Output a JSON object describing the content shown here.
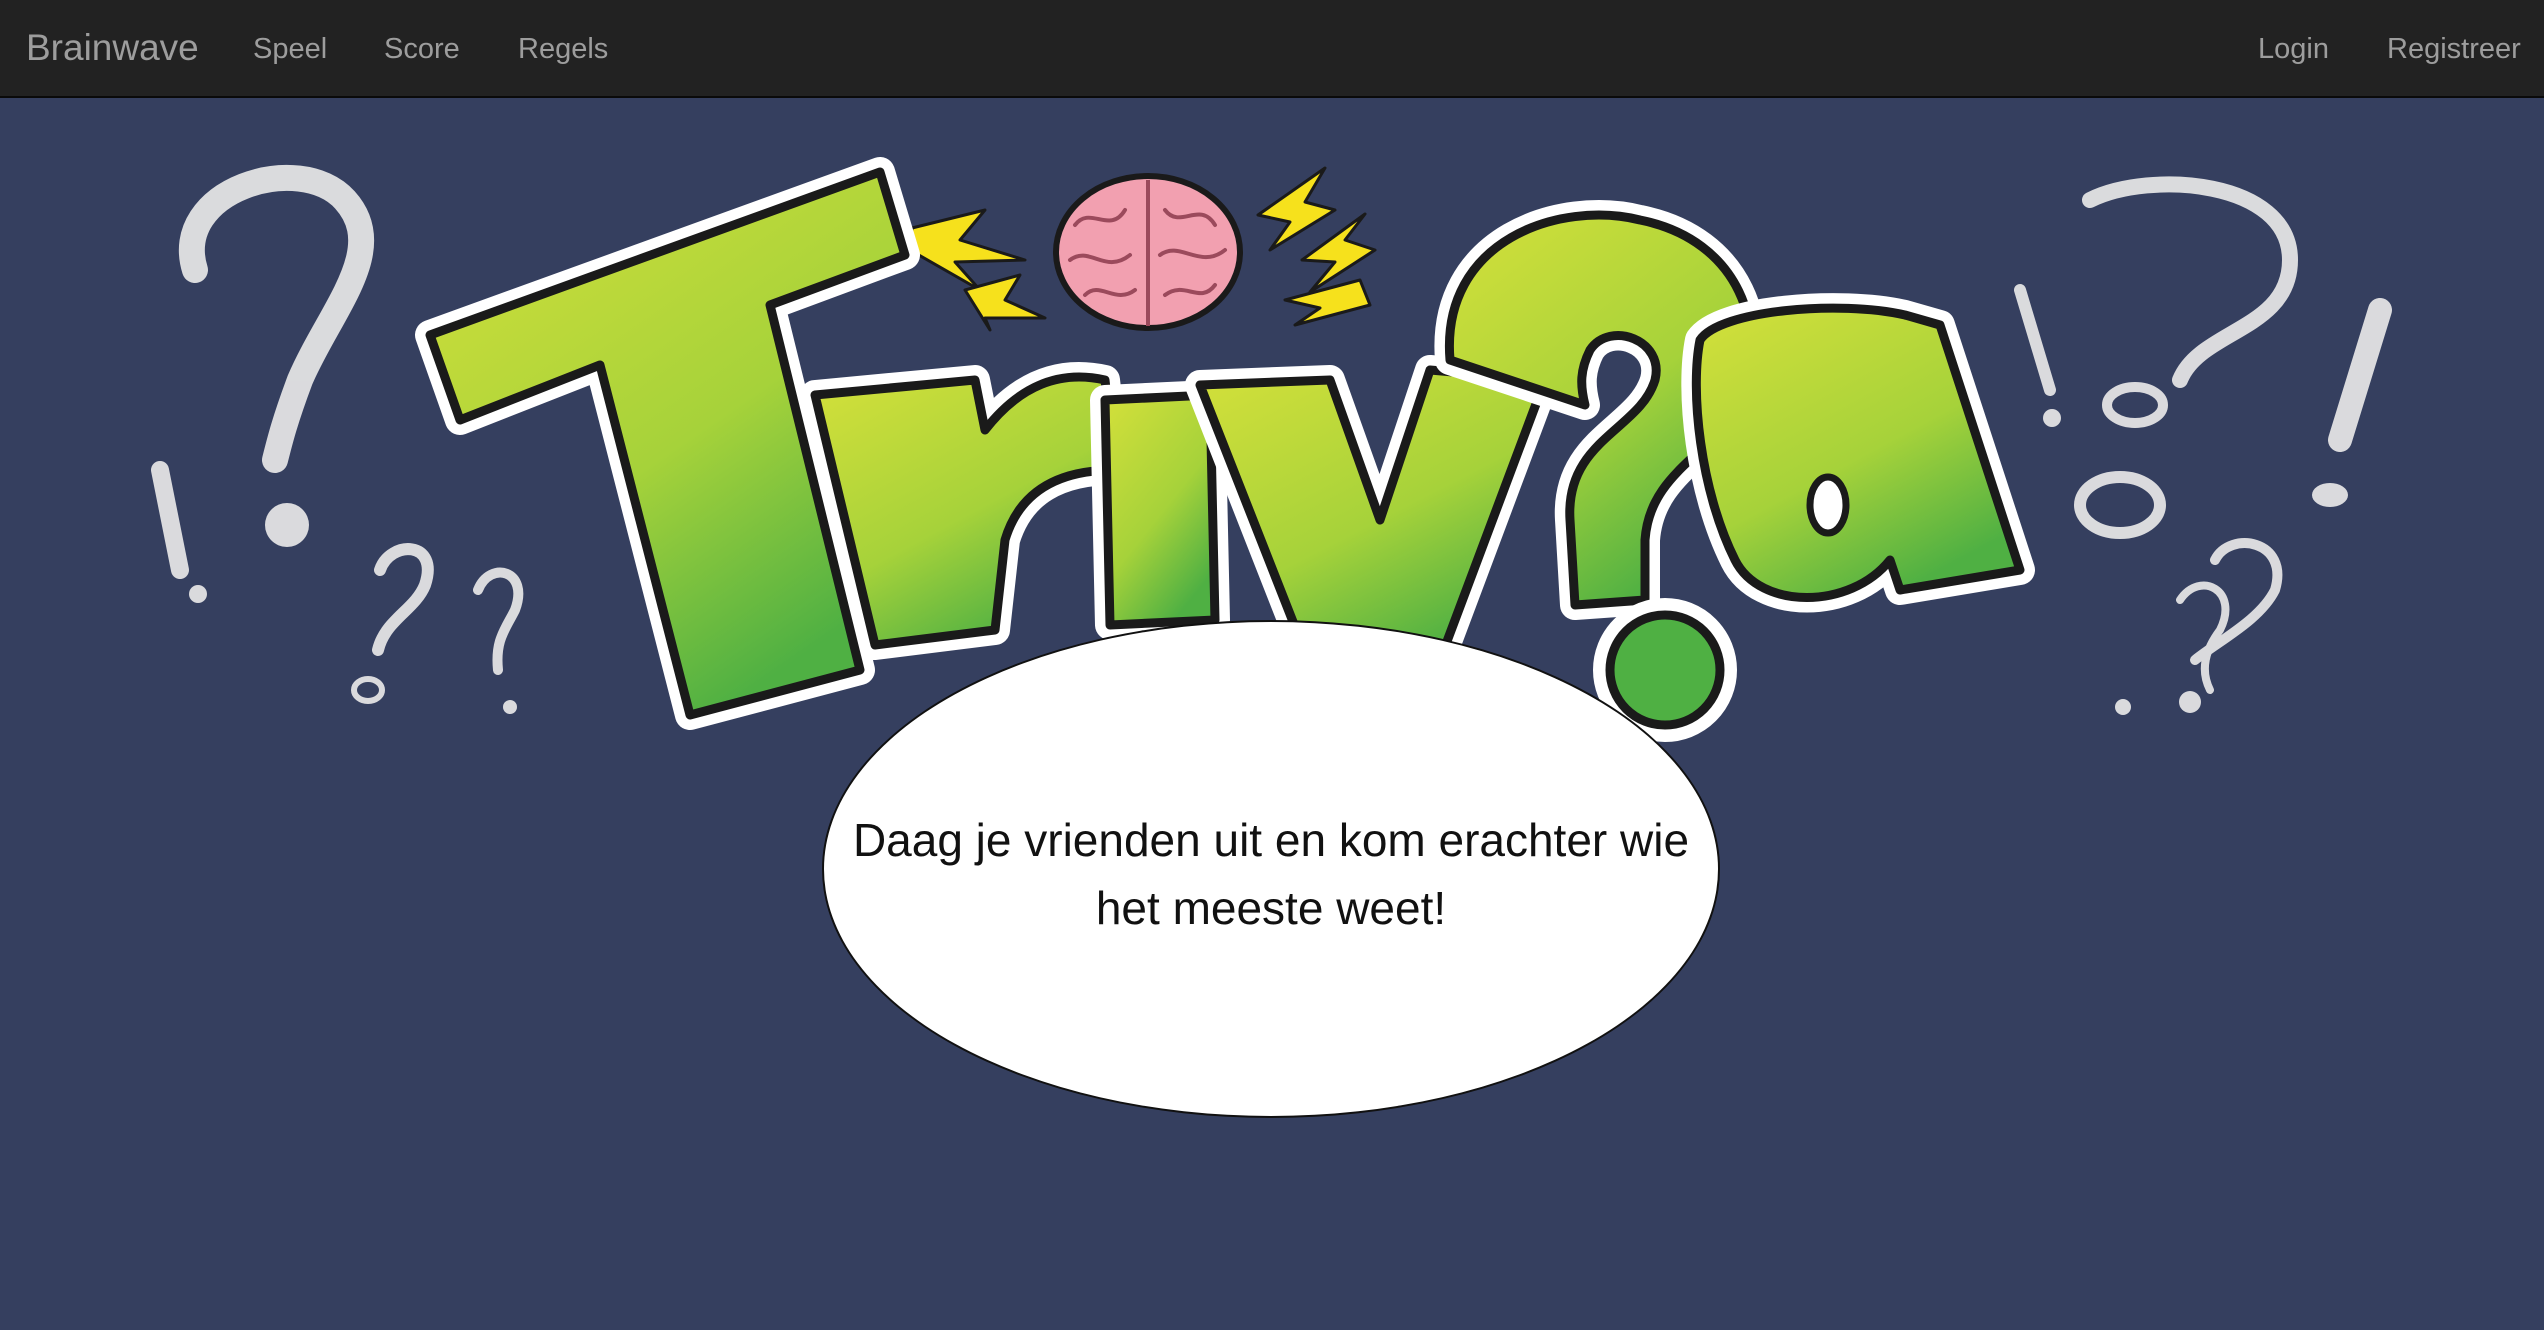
{
  "navbar": {
    "brand": "Brainwave",
    "links": [
      "Speel",
      "Score",
      "Regels"
    ],
    "right_links": [
      "Login",
      "Registreer"
    ]
  },
  "hero": {
    "logo_text": "Triv?a",
    "tagline": "Daag je vrienden uit en kom erachter wie het meeste weet!"
  },
  "colors": {
    "navbar_bg": "#222222",
    "page_bg": "#353f5f",
    "logo_green_light": "#d4e03a",
    "logo_green_dark": "#4fb043",
    "brain_pink": "#f2a0b0",
    "bolt_yellow": "#f6e11c"
  }
}
